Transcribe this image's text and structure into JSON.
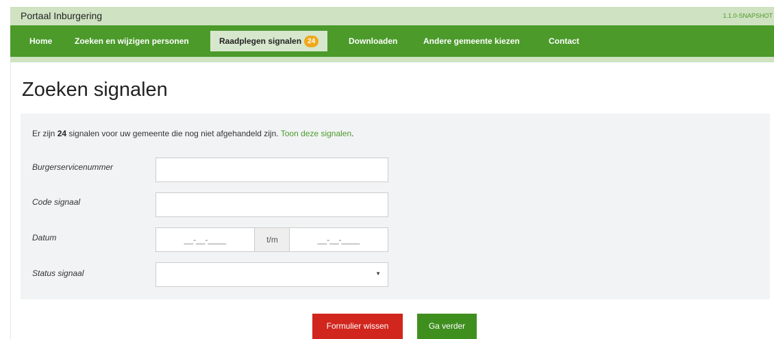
{
  "app": {
    "title": "Portaal Inburgering",
    "version": "1.1.0-SNAPSHOT"
  },
  "nav": {
    "items": [
      {
        "label": "Home"
      },
      {
        "label": "Zoeken en wijzigen personen"
      },
      {
        "label": "Raadplegen signalen",
        "badge": "24",
        "active": true
      },
      {
        "label": "Downloaden"
      },
      {
        "label": "Andere gemeente kiezen"
      },
      {
        "label": "Contact"
      }
    ]
  },
  "page": {
    "title": "Zoeken signalen"
  },
  "info": {
    "prefix": "Er zijn ",
    "count": "24",
    "suffix": " signalen voor uw gemeente die nog niet afgehandeld zijn. ",
    "link": "Toon deze signalen",
    "end": "."
  },
  "form": {
    "bsn_label": "Burgerservicenummer",
    "bsn_value": "",
    "code_label": "Code signaal",
    "code_value": "",
    "date_label": "Datum",
    "date_from_placeholder": "__-__-____",
    "date_separator": "t/m",
    "date_to_placeholder": "__-__-____",
    "status_label": "Status signaal",
    "status_value": ""
  },
  "buttons": {
    "clear": "Formulier wissen",
    "next": "Ga verder"
  },
  "colors": {
    "green": "#4b9a2a",
    "light_green": "#cfe2c2",
    "badge": "#f0a81c",
    "red": "#d1261d"
  }
}
